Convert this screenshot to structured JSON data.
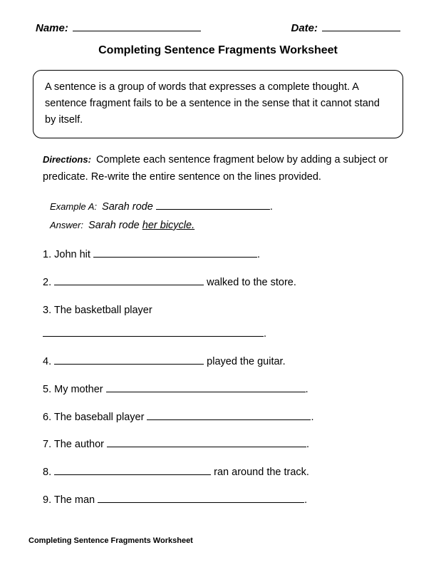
{
  "header": {
    "name_label": "Name:",
    "date_label": "Date:"
  },
  "title": "Completing Sentence Fragments Worksheet",
  "definition": "A sentence is a group of words that expresses a complete thought. A sentence fragment fails to be a sentence in the sense that it cannot stand by itself.",
  "directions": {
    "label": "Directions:",
    "text": "Complete each sentence fragment below by adding a subject or predicate. Re-write the entire sentence on the lines provided."
  },
  "example": {
    "label_a": "Example A:",
    "text_a_prefix": "Sarah rode",
    "label_answer": "Answer:",
    "answer_prefix": "Sarah rode",
    "answer_underlined": "her bicycle."
  },
  "questions": [
    {
      "num": "1.",
      "before": "John hit",
      "blank_width": 230,
      "after": "."
    },
    {
      "num": "2.",
      "before": "",
      "blank_width": 210,
      "after": " walked to the store."
    },
    {
      "num": "3.",
      "before": "The basketball player",
      "blank_width": 0,
      "after": "",
      "second_line_blank": 310
    },
    {
      "num": "4.",
      "before": "",
      "blank_width": 210,
      "after": " played the guitar."
    },
    {
      "num": "5.",
      "before": "My mother ",
      "blank_width": 280,
      "after": "."
    },
    {
      "num": "6.",
      "before": "The baseball player ",
      "blank_width": 230,
      "after": "."
    },
    {
      "num": "7.",
      "before": "The author ",
      "blank_width": 280,
      "after": "."
    },
    {
      "num": "8.",
      "before": "",
      "blank_width": 220,
      "after": " ran around the track."
    },
    {
      "num": "9.",
      "before": "The man ",
      "blank_width": 290,
      "after": "."
    }
  ],
  "footer": "Completing Sentence Fragments Worksheet"
}
